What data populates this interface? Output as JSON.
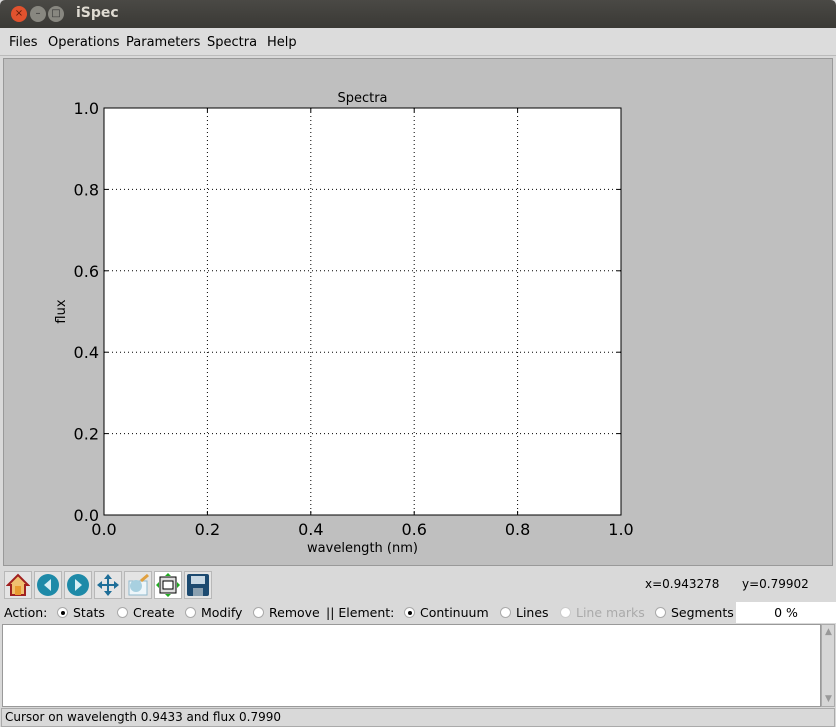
{
  "window": {
    "title": "iSpec",
    "close": "×",
    "minimize": "–",
    "maximize": "□"
  },
  "menu": [
    "Files",
    "Operations",
    "Parameters",
    "Spectra",
    "Help"
  ],
  "chart_data": {
    "type": "line",
    "title": "Spectra",
    "xlabel": "wavelength (nm)",
    "ylabel": "flux",
    "xlim": [
      0.0,
      1.0
    ],
    "ylim": [
      0.0,
      1.0
    ],
    "xticks": [
      "0.0",
      "0.2",
      "0.4",
      "0.6",
      "0.8",
      "1.0"
    ],
    "yticks": [
      "0.0",
      "0.2",
      "0.4",
      "0.6",
      "0.8",
      "1.0"
    ],
    "grid": true,
    "series": []
  },
  "toolbar": {
    "icons": [
      "home-icon",
      "back-icon",
      "forward-icon",
      "pan-icon",
      "zoom-icon",
      "subplots-icon",
      "save-icon"
    ]
  },
  "coords": {
    "x": "x=0.943278",
    "y": "y=0.79902"
  },
  "action": {
    "label": "Action:",
    "options": [
      {
        "label": "Stats",
        "checked": true
      },
      {
        "label": "Create",
        "checked": false
      },
      {
        "label": "Modify",
        "checked": false
      },
      {
        "label": "Remove",
        "checked": false
      }
    ],
    "element_label": "|| Element:",
    "elements": [
      {
        "label": "Continuum",
        "checked": true
      },
      {
        "label": "Lines",
        "checked": false
      },
      {
        "label": "Line marks",
        "checked": false,
        "disabled": true
      },
      {
        "label": "Segments",
        "checked": false
      }
    ]
  },
  "progress": "0 %",
  "status": "Cursor on wavelength 0.9433 and flux 0.7990"
}
